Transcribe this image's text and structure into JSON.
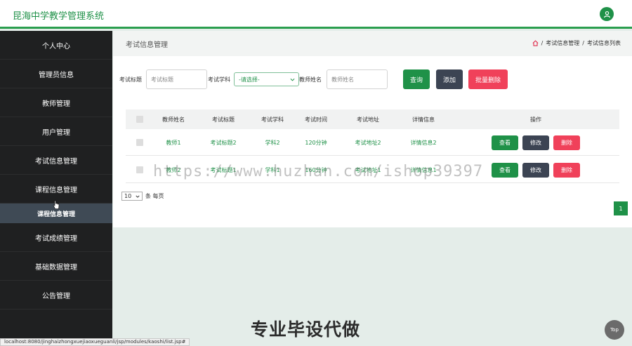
{
  "app": {
    "title": "昆海中学教学管理系统"
  },
  "sidebar": {
    "items": [
      {
        "label": "个人中心"
      },
      {
        "label": "管理员信息"
      },
      {
        "label": "教师管理"
      },
      {
        "label": "用户管理"
      },
      {
        "label": "考试信息管理"
      },
      {
        "label": "课程信息管理"
      },
      {
        "label": "考试成绩管理"
      },
      {
        "label": "基础数据管理"
      },
      {
        "label": "公告管理"
      }
    ],
    "active_sub": "课程信息管理"
  },
  "page": {
    "title": "考试信息管理",
    "breadcrumb": [
      "考试信息管理",
      "考试信息列表"
    ]
  },
  "filters": {
    "title_label": "考试标题",
    "title_placeholder": "考试标题",
    "subject_label": "考试学科",
    "subject_value": "-请选择-",
    "teacher_label": "教师姓名",
    "teacher_placeholder": "教师姓名"
  },
  "toolbar": {
    "search": "查询",
    "add": "添加",
    "batch_delete": "批量删除"
  },
  "table": {
    "headers": [
      "教师姓名",
      "考试标题",
      "考试学科",
      "考试时间",
      "考试地址",
      "详情信息",
      "操作"
    ],
    "rows": [
      {
        "teacher": "教师1",
        "title": "考试标题2",
        "subject": "学科2",
        "time": "120分钟",
        "address": "考试地址2",
        "detail": "详情信息2"
      },
      {
        "teacher": "教师2",
        "title": "考试标题1",
        "subject": "学科1",
        "time": "160分钟",
        "address": "考试地址1",
        "detail": "详情信息1"
      }
    ],
    "actions": {
      "view": "查看",
      "edit": "修改",
      "delete": "删除"
    }
  },
  "pagination": {
    "page_size": "10",
    "page_size_suffix": "条 每页",
    "current_page": "1"
  },
  "overlay": {
    "watermark": "https://www.huzhan.com/ishop39397",
    "ad_text": "专业毕设代做",
    "status_url": "localhost:8080/jinghaizhongxuejiaoxueguanli/jsp/modules/kaoshi/list.jsp#",
    "top_button": "Top"
  },
  "colors": {
    "brand_green": "#1f9148",
    "sidebar_bg": "#1f2021",
    "add_button": "#3c4453",
    "delete_button": "#f0415a",
    "active_sub_bg": "#3f4a55"
  }
}
